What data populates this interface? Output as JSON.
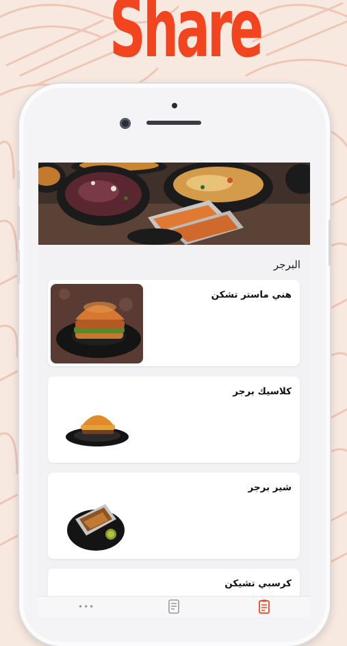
{
  "promo": {
    "logo_text": "Share",
    "colors": {
      "background": "#f7e9df",
      "accent": "#f2451f"
    }
  },
  "menu": {
    "section_title": "البرجر",
    "items": [
      {
        "name": "هني ماستر تشكن",
        "image": "crispy-chicken-burger"
      },
      {
        "name": "كلاسيك برجر",
        "image": "classic-burger"
      },
      {
        "name": "شير برجر",
        "image": "share-burger"
      },
      {
        "name": "كرسبي تشيكن",
        "image": "crispy-chicken"
      }
    ]
  },
  "tabbar": {
    "tabs": [
      {
        "icon": "more-icon",
        "label": ""
      },
      {
        "icon": "document-icon",
        "label": ""
      },
      {
        "icon": "menu-icon",
        "label": ""
      }
    ],
    "active_color": "#f2451f"
  }
}
